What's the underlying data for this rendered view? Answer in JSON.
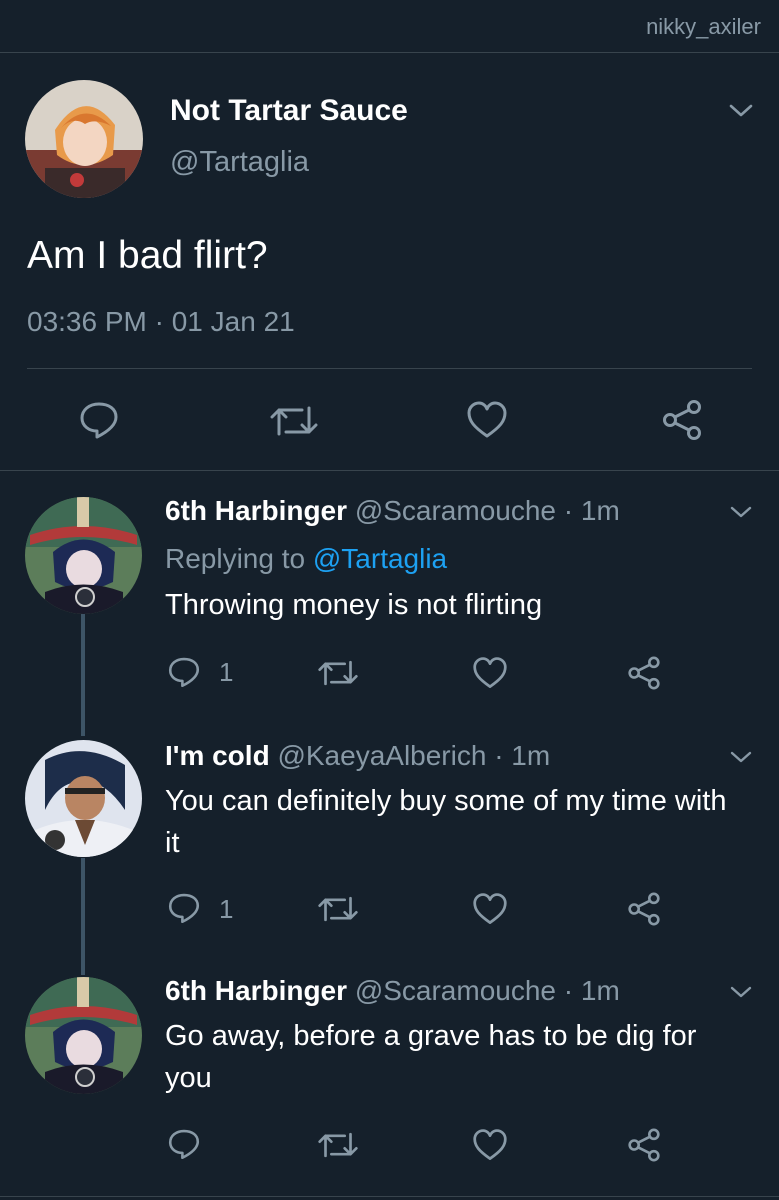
{
  "watermark": "nikky_axiler",
  "main_tweet": {
    "display_name": "Not Tartar Sauce",
    "handle": "@Tartaglia",
    "text": "Am I bad flirt?",
    "timestamp": "03:36 PM · 01 Jan 21"
  },
  "replies": [
    {
      "display_name": "6th Harbinger",
      "handle_time": "@Scaramouche · 1m",
      "replying_label": "Replying to ",
      "replying_to": "@Tartaglia",
      "text": "Throwing money is not flirting",
      "reply_count": "1"
    },
    {
      "display_name": "I'm cold",
      "handle_time": "@KaeyaAlberich · 1m",
      "text": "You can definitely buy some of my time with it",
      "reply_count": "1"
    },
    {
      "display_name": "6th Harbinger",
      "handle_time": "@Scaramouche · 1m",
      "text": "Go away, before a grave has to be dig for you",
      "reply_count": ""
    }
  ],
  "colors": {
    "background": "#15202b",
    "secondary_text": "#8899a6",
    "link": "#1da1f2",
    "divider": "#38444d"
  }
}
